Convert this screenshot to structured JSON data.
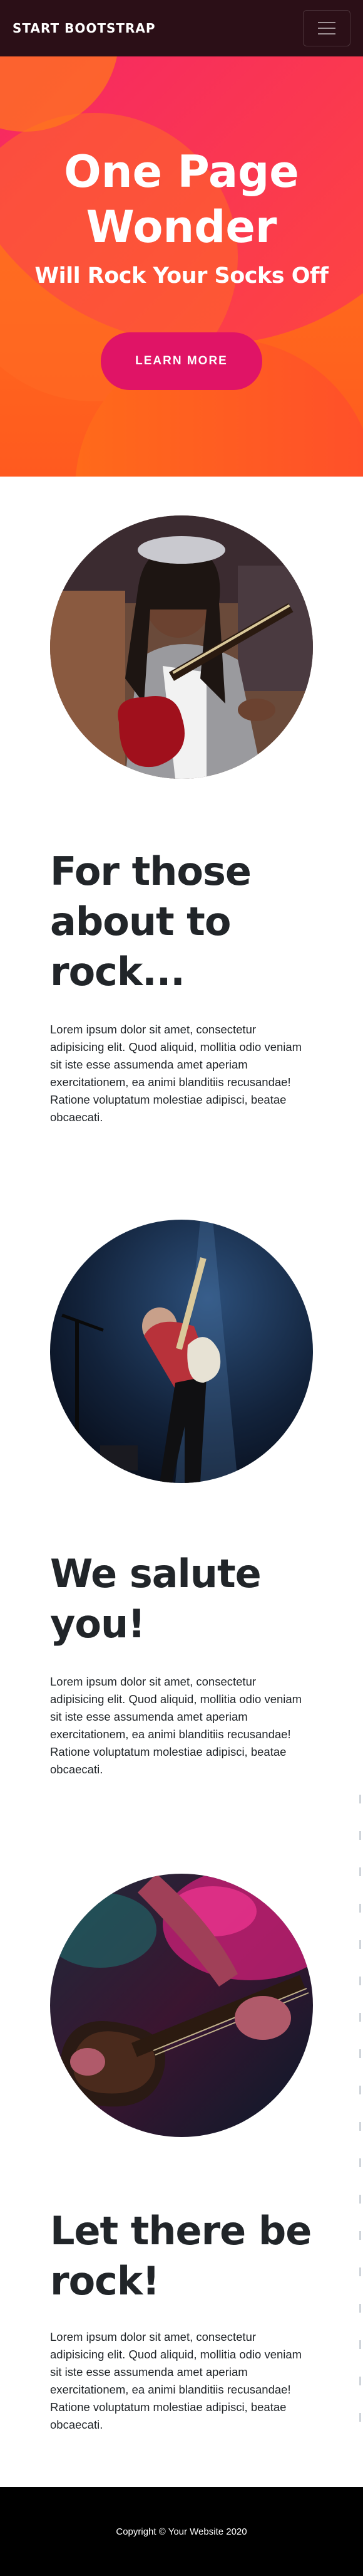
{
  "navbar": {
    "brand": "Start Bootstrap",
    "toggler_icon": "hamburger-icon"
  },
  "hero": {
    "title_line1": "One Page",
    "title_line2": "Wonder",
    "subtitle": "Will Rock Your Socks Off",
    "button_label": "Learn More"
  },
  "sections": [
    {
      "title_line1": "For those",
      "title_line2": "about to",
      "title_line3": "rock...",
      "text": "Lorem ipsum dolor sit amet, consectetur adipisicing elit. Quod aliquid, mollitia odio veniam sit iste esse assumenda amet aperiam exercitationem, ea animi blanditiis recusandae! Ratione voluptatum molestiae adipisci, beatae obcaecati.",
      "image": "guitarist-woman-photo"
    },
    {
      "title_line1": "We salute",
      "title_line2": "you!",
      "text": "Lorem ipsum dolor sit amet, consectetur adipisicing elit. Quod aliquid, mollitia odio veniam sit iste esse assumenda amet aperiam exercitationem, ea animi blanditiis recusandae! Ratione voluptatum molestiae adipisci, beatae obcaecati.",
      "image": "concert-guitarist-photo"
    },
    {
      "title_line1": "Let there be",
      "title_line2": "rock!",
      "text": "Lorem ipsum dolor sit amet, consectetur adipisicing elit. Quod aliquid, mollitia odio veniam sit iste esse assumenda amet aperiam exercitationem, ea animi blanditiis recusandae! Ratione voluptatum molestiae adipisci, beatae obcaecati.",
      "image": "guitar-closeup-photo"
    }
  ],
  "footer": {
    "copyright": "Copyright © Your Website 2020"
  },
  "colors": {
    "navbar_bg": "#2b0f17",
    "hero_orange": "#ff6a1a",
    "hero_pink": "#ee0979",
    "button_pink": "#e01466",
    "text_dark": "#212529",
    "footer_bg": "#000000"
  }
}
